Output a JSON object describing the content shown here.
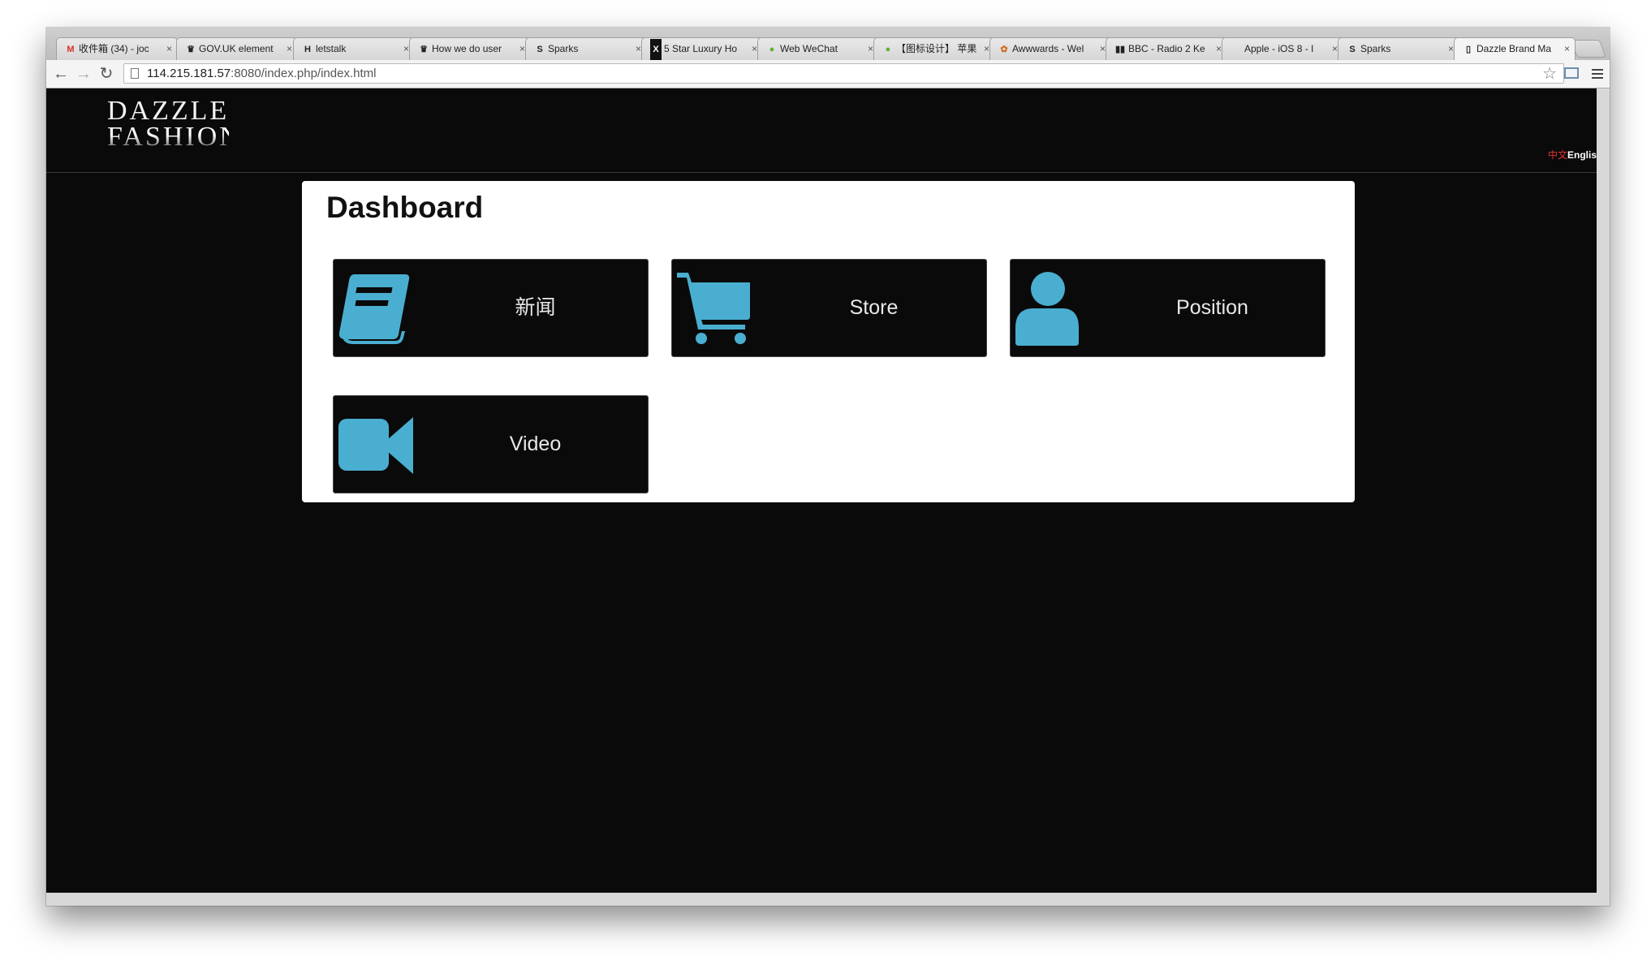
{
  "browser": {
    "tabs": [
      {
        "icon": "gmail-icon",
        "glyph": "M",
        "title": "收件箱 (34) - joc"
      },
      {
        "icon": "gov-uk-icon",
        "glyph": "♛",
        "title": "GOV.UK element"
      },
      {
        "icon": "letstalk-icon",
        "glyph": "H",
        "title": "letstalk"
      },
      {
        "icon": "gov-uk-icon",
        "glyph": "♛",
        "title": "How we do user"
      },
      {
        "icon": "sparks-icon",
        "glyph": "S",
        "title": "Sparks"
      },
      {
        "icon": "luxury-icon",
        "glyph": "X",
        "title": "5 Star Luxury Ho"
      },
      {
        "icon": "wechat-icon",
        "glyph": "●",
        "title": "Web WeChat"
      },
      {
        "icon": "wechat-icon",
        "glyph": "●",
        "title": "【图标设计】 苹果"
      },
      {
        "icon": "awwwards-icon",
        "glyph": "✿",
        "title": "Awwwards - Wel"
      },
      {
        "icon": "bbc-icon",
        "glyph": "▮▮",
        "title": "BBC - Radio 2 Ke"
      },
      {
        "icon": "apple-icon",
        "glyph": "",
        "title": "Apple - iOS 8 - I"
      },
      {
        "icon": "sparks-icon",
        "glyph": "S",
        "title": "Sparks"
      },
      {
        "icon": "page-icon",
        "glyph": "▯",
        "title": "Dazzle Brand Ma"
      }
    ],
    "tab_close": "×",
    "url_host": "114.215.181.57",
    "url_rest": ":8080/index.php/index.html",
    "nav": {
      "back": "←",
      "forward": "→",
      "reload": "↻",
      "star": "☆"
    }
  },
  "site": {
    "logo_line1": "DAZZLE",
    "logo_line2": "FASHION",
    "lang_zh": "中文",
    "lang_en": "Englis"
  },
  "dashboard": {
    "title": "Dashboard",
    "tiles": [
      {
        "label": "新闻",
        "icon": "book-icon"
      },
      {
        "label": "Store",
        "icon": "shopping-cart-icon"
      },
      {
        "label": "Position",
        "icon": "user-icon"
      },
      {
        "label": "Video",
        "icon": "video-camera-icon"
      }
    ]
  },
  "colors": {
    "accent": "#4aaed0",
    "background": "#0a0a0a",
    "panel": "#ffffff",
    "lang_active": "#e0332e"
  }
}
